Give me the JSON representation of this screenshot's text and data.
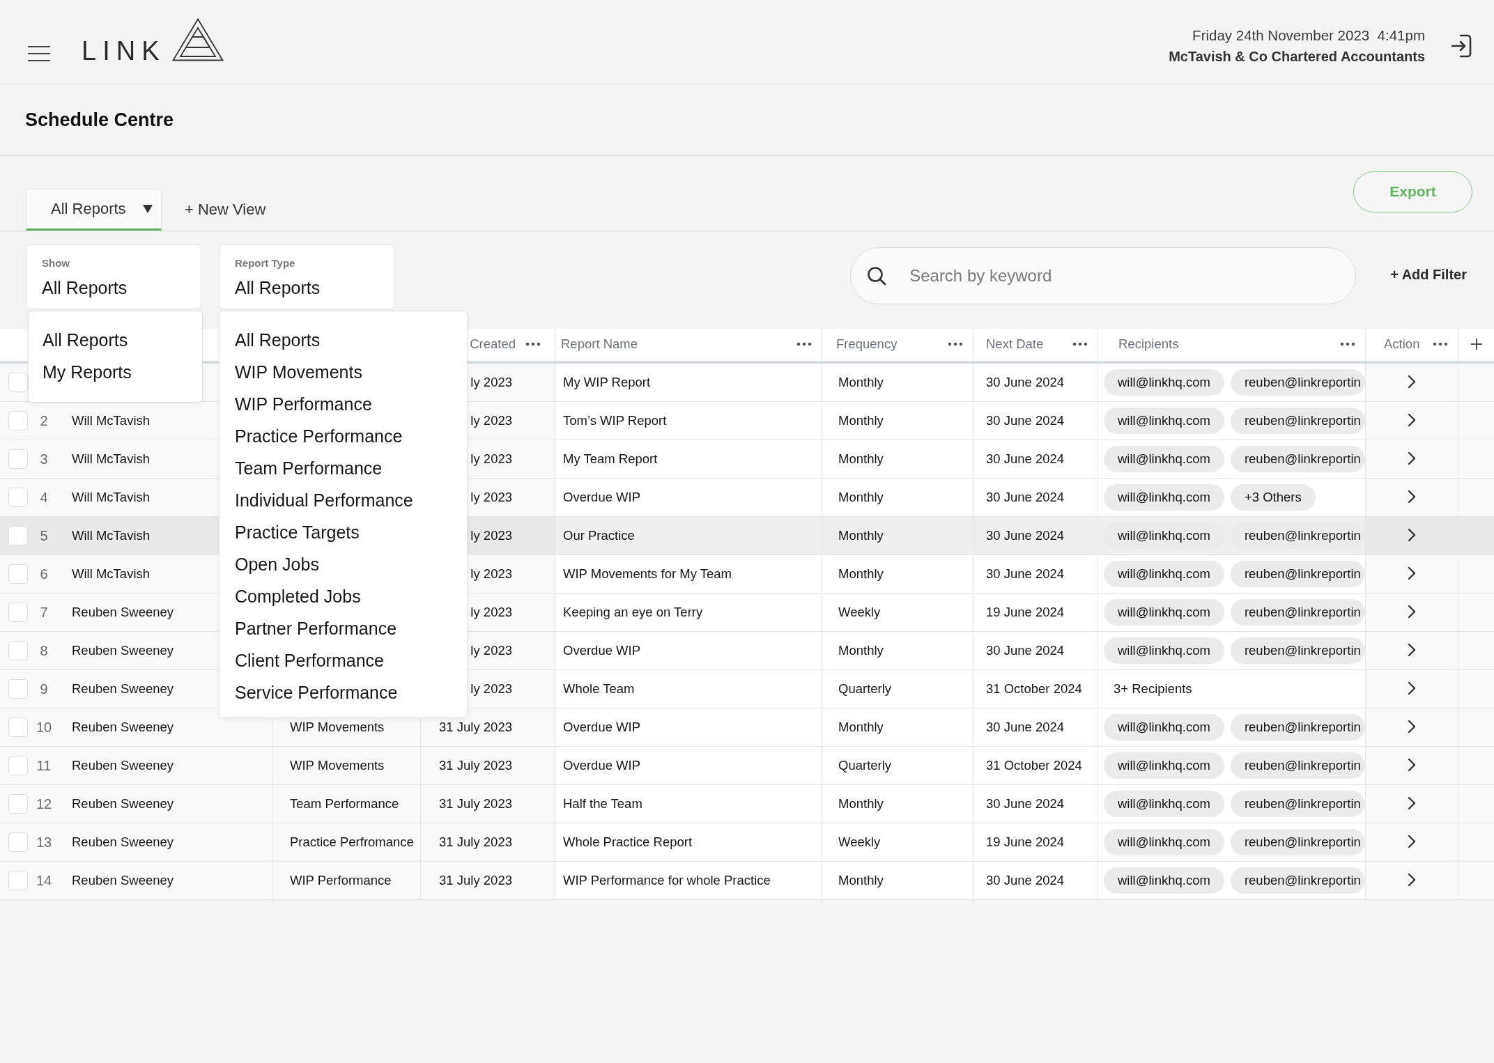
{
  "header": {
    "logo": "LINK",
    "datetime": "Friday 24th November 2023  4:41pm",
    "company": "McTavish & Co Chartered Accountants"
  },
  "page_title": "Schedule Centre",
  "views": [
    {
      "label": "All Reports",
      "selected": true
    }
  ],
  "new_view_button": "+ New View",
  "export_button": "Export",
  "filters": [
    {
      "label": "Show",
      "value": "All Reports",
      "expanded": true,
      "menu": [
        "All Reports",
        "My Reports"
      ]
    },
    {
      "label": "Report Type",
      "value": "All Reports",
      "expanded": true,
      "menu": [
        "All Reports",
        "WIP Movements",
        "WIP Performance",
        "Practice Performance",
        "Team Performance",
        "Individual Performance",
        "Practice Targets",
        "Open Jobs",
        "Completed Jobs",
        "Partner Performance",
        "Client Performance",
        "Service Performance"
      ]
    }
  ],
  "search": {
    "placeholder": "Search by keyword"
  },
  "add_filter_button": "+ Add Filter",
  "table": {
    "columns": [
      "Created",
      "Report Name",
      "Frequency",
      "Next Date",
      "Recipients",
      "Action"
    ],
    "rows": [
      {
        "checked": false,
        "highlighted": false,
        "created": "ly 2023",
        "report_name": "My WIP Report",
        "frequency": "Monthly",
        "next_date": "30 June 2024",
        "recipients": [
          "will@linkhq.com",
          "reuben@linkreportin"
        ]
      },
      {
        "checked": false,
        "highlighted": false,
        "number": "2",
        "column_2": "Will McTavish",
        "created": "ly 2023",
        "report_name": "Tom’s WIP Report",
        "frequency": "Monthly",
        "next_date": "30 June 2024",
        "recipients": [
          "will@linkhq.com",
          "reuben@linkreportin"
        ]
      },
      {
        "checked": false,
        "highlighted": false,
        "number": "3",
        "column_2": "Will McTavish",
        "created": "ly 2023",
        "report_name": "My Team Report",
        "frequency": "Monthly",
        "next_date": "30 June 2024",
        "recipients": [
          "will@linkhq.com",
          "reuben@linkreportin"
        ]
      },
      {
        "checked": false,
        "highlighted": false,
        "number": "4",
        "column_2": "Will McTavish",
        "created": "ly 2023",
        "report_name": "Overdue WIP",
        "frequency": "Monthly",
        "next_date": "30 June 2024",
        "recipients": [
          "will@linkhq.com",
          "+3 Others"
        ]
      },
      {
        "checked": false,
        "highlighted": true,
        "number": "5",
        "column_2": "Will McTavish",
        "created": "ly 2023",
        "report_name": "Our Practice",
        "frequency": "Monthly",
        "next_date": "30 June 2024",
        "recipients": [
          "will@linkhq.com",
          "reuben@linkreportin"
        ]
      },
      {
        "checked": false,
        "highlighted": false,
        "number": "6",
        "column_2": "Will McTavish",
        "created": "ly 2023",
        "report_name": "WIP Movements for My Team",
        "frequency": "Monthly",
        "next_date": "30 June 2024",
        "recipients": [
          "will@linkhq.com",
          "reuben@linkreportin"
        ]
      },
      {
        "checked": false,
        "highlighted": false,
        "number": "7",
        "column_2": "Reuben Sweeney",
        "created": "ly 2023",
        "report_name": "Keeping an eye on Terry",
        "frequency": "Weekly",
        "next_date": "19 June 2024",
        "recipients": [
          "will@linkhq.com",
          "reuben@linkreportin"
        ]
      },
      {
        "checked": false,
        "highlighted": false,
        "number": "8",
        "column_2": "Reuben Sweeney",
        "created": "ly 2023",
        "report_name": "Overdue WIP",
        "frequency": "Monthly",
        "next_date": "30 June 2024",
        "recipients": [
          "will@linkhq.com",
          "reuben@linkreportin"
        ]
      },
      {
        "checked": false,
        "highlighted": false,
        "number": "9",
        "column_2": "Reuben Sweeney",
        "created": "ly 2023",
        "report_name": "Whole Team",
        "frequency": "Quarterly",
        "next_date": "31 October 2024",
        "recipients_summary": "3+ Recipients"
      },
      {
        "checked": false,
        "highlighted": false,
        "number": "10",
        "column_2": "Reuben Sweeney",
        "column_3": "WIP Movements",
        "created": "31 July 2023",
        "report_name": "Overdue WIP",
        "frequency": "Monthly",
        "next_date": "30 June 2024",
        "recipients": [
          "will@linkhq.com",
          "reuben@linkreportin"
        ]
      },
      {
        "checked": false,
        "highlighted": false,
        "number": "11",
        "column_2": "Reuben Sweeney",
        "column_3": "WIP Movements",
        "created": "31 July 2023",
        "report_name": "Overdue WIP",
        "frequency": "Quarterly",
        "next_date": "31 October 2024",
        "recipients": [
          "will@linkhq.com",
          "reuben@linkreportin"
        ]
      },
      {
        "checked": false,
        "highlighted": false,
        "number": "12",
        "column_2": "Reuben Sweeney",
        "column_3": "Team Performance",
        "created": "31 July 2023",
        "report_name": "Half the Team",
        "frequency": "Monthly",
        "next_date": "30 June 2024",
        "recipients": [
          "will@linkhq.com",
          "reuben@linkreportin"
        ]
      },
      {
        "checked": false,
        "highlighted": false,
        "number": "13",
        "column_2": "Reuben Sweeney",
        "column_3": "Practice Perfromance",
        "created": "31 July 2023",
        "report_name": "Whole Practice Report",
        "frequency": "Weekly",
        "next_date": "19 June 2024",
        "recipients": [
          "will@linkhq.com",
          "reuben@linkreportin"
        ]
      },
      {
        "checked": false,
        "highlighted": false,
        "number": "14",
        "column_2": "Reuben Sweeney",
        "column_3": "WIP Performance",
        "created": "31 July 2023",
        "report_name": "WIP Performance for whole Practice",
        "frequency": "Monthly",
        "next_date": "30 June 2024",
        "recipients": [
          "will@linkhq.com",
          "reuben@linkreportin"
        ]
      }
    ]
  }
}
